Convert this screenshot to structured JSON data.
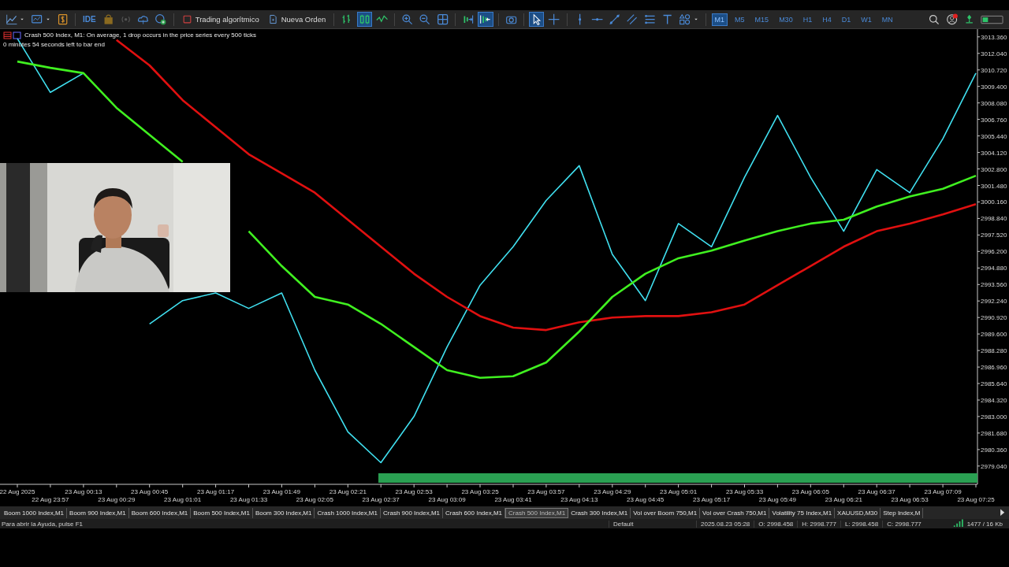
{
  "toolbar": {
    "ide_label": "IDE",
    "buttons": [
      {
        "label": "Trading algorítmico",
        "kind": "algo"
      },
      {
        "label": "Nueva Orden",
        "kind": "order"
      }
    ],
    "timeframes": [
      {
        "label": "M1",
        "selected": true
      },
      {
        "label": "M5",
        "selected": false
      },
      {
        "label": "M15",
        "selected": false
      },
      {
        "label": "M30",
        "selected": false
      },
      {
        "label": "H1",
        "selected": false
      },
      {
        "label": "H4",
        "selected": false
      },
      {
        "label": "D1",
        "selected": false
      },
      {
        "label": "W1",
        "selected": false
      },
      {
        "label": "MN",
        "selected": false
      }
    ]
  },
  "chart": {
    "info_lines": [
      "Crash 500 Index, M1:  On average, 1 drop occurs in the price series every 500 ticks",
      "0 minutes 54 seconds left to bar end"
    ],
    "chart_data": {
      "type": "line",
      "categories": [
        "22 Aug 2025",
        "22 Aug 23:57",
        "23 Aug 00:13",
        "23 Aug 00:29",
        "23 Aug 00:45",
        "23 Aug 01:01",
        "23 Aug 01:17",
        "23 Aug 01:33",
        "23 Aug 01:49",
        "23 Aug 02:05",
        "23 Aug 02:21",
        "23 Aug 02:37",
        "23 Aug 02:53",
        "23 Aug 03:09",
        "23 Aug 03:25",
        "23 Aug 03:41",
        "23 Aug 03:57",
        "23 Aug 04:13",
        "23 Aug 04:29",
        "23 Aug 04:45",
        "23 Aug 05:01",
        "23 Aug 05:17",
        "23 Aug 05:33",
        "23 Aug 05:49",
        "23 Aug 06:05",
        "23 Aug 06:21",
        "23 Aug 06:37",
        "23 Aug 06:53",
        "23 Aug 07:09",
        "23 Aug 07:25"
      ],
      "ylim": [
        2977.58,
        3013.98
      ],
      "yticks": [
        {
          "value": 3013.36,
          "label": "3013.360"
        },
        {
          "value": 3012.04,
          "label": "3012.040"
        },
        {
          "value": 3010.72,
          "label": "3010.720"
        },
        {
          "value": 3009.4,
          "label": "3009.400"
        },
        {
          "value": 3008.08,
          "label": "3008.080"
        },
        {
          "value": 3006.76,
          "label": "3006.760"
        },
        {
          "value": 3005.44,
          "label": "3005.440"
        },
        {
          "value": 3004.12,
          "label": "3004.120"
        },
        {
          "value": 3002.8,
          "label": "3002.800"
        },
        {
          "value": 3001.48,
          "label": "3001.480"
        },
        {
          "value": 3000.16,
          "label": "3000.160"
        },
        {
          "value": 2998.84,
          "label": "2998.840"
        },
        {
          "value": 2997.52,
          "label": "2997.520"
        },
        {
          "value": 2996.2,
          "label": "2996.200"
        },
        {
          "value": 2994.88,
          "label": "2994.880"
        },
        {
          "value": 2993.56,
          "label": "2993.560"
        },
        {
          "value": 2992.24,
          "label": "2992.240"
        },
        {
          "value": 2990.92,
          "label": "2990.920"
        },
        {
          "value": 2989.6,
          "label": "2989.600"
        },
        {
          "value": 2988.28,
          "label": "2988.280"
        },
        {
          "value": 2986.96,
          "label": "2986.960"
        },
        {
          "value": 2985.64,
          "label": "2985.640"
        },
        {
          "value": 2984.32,
          "label": "2984.320"
        },
        {
          "value": 2983,
          "label": "2983.000"
        },
        {
          "value": 2981.68,
          "label": "2981.680"
        },
        {
          "value": 2980.36,
          "label": "2980.360"
        },
        {
          "value": 2979.04,
          "label": "2979.040"
        }
      ],
      "series": [
        {
          "color": "#40e0f0",
          "values": [
            3013.24,
            3008.92,
            3010.46,
            null,
            2990.41,
            2992.27,
            2992.88,
            2991.65,
            2992.88,
            2986.71,
            2981.78,
            2979.31,
            2983.01,
            2988.56,
            2993.5,
            2996.58,
            3000.28,
            3003.06,
            2995.97,
            2992.27,
            2998.43,
            2996.58,
            3002.13,
            3007.07,
            3002.13,
            2997.82,
            3002.75,
            3000.9,
            3005.22,
            3010.46
          ]
        },
        {
          "color": "#e01010",
          "values": [
            null,
            null,
            null,
            3013.11,
            3011.08,
            3008.3,
            3006.14,
            3003.98,
            3002.44,
            3000.9,
            2998.74,
            2996.58,
            2994.42,
            2992.57,
            2991.03,
            2990.11,
            2989.92,
            2990.54,
            2990.91,
            2991.03,
            2991.03,
            2991.34,
            2991.96,
            2993.5,
            2995.04,
            2996.58,
            2997.82,
            2998.43,
            2999.17,
            2999.98
          ]
        },
        {
          "color": "#40f020",
          "values": [
            3011.39,
            3010.89,
            3010.46,
            3007.69,
            3005.53,
            3003.37,
            null,
            2997.82,
            2995.04,
            2992.57,
            2991.96,
            2990.41,
            2988.56,
            2986.71,
            2986.1,
            2986.22,
            2987.33,
            2989.8,
            2992.57,
            2994.42,
            2995.66,
            2996.27,
            2997.08,
            2997.82,
            2998.43,
            2998.74,
            2999.79,
            3000.59,
            3001.21,
            3002.26
          ]
        }
      ]
    }
  },
  "symbol_tabs": [
    {
      "label": "Boom 1000 Index,M1",
      "selected": false
    },
    {
      "label": "Boom 900 Index,M1",
      "selected": false
    },
    {
      "label": "Boom 600 Index,M1",
      "selected": false
    },
    {
      "label": "Boom 500 Index,M1",
      "selected": false
    },
    {
      "label": "Boom 300 Index,M1",
      "selected": false
    },
    {
      "label": "Crash 1000 Index,M1",
      "selected": false
    },
    {
      "label": "Crash 900 Index,M1",
      "selected": false
    },
    {
      "label": "Crash 600 Index,M1",
      "selected": false
    },
    {
      "label": "Crash 500 Index,M1",
      "selected": true
    },
    {
      "label": "Crash 300 Index,M1",
      "selected": false
    },
    {
      "label": "Vol over Boom 750,M1",
      "selected": false
    },
    {
      "label": "Vol over Crash 750,M1",
      "selected": false
    },
    {
      "label": "Volatility 75 Index,M1",
      "selected": false
    },
    {
      "label": "XAUUSD,M30",
      "selected": false
    },
    {
      "label": "Step Index,M",
      "selected": false
    }
  ],
  "status_bar": {
    "help": "Para abrir la Ayuda, pulse F1",
    "profile": "Default",
    "datetime": "2025.08.23 05:28",
    "open": "O: 2998.458",
    "high": "H: 2998.777",
    "low": "L: 2998.458",
    "close": "C: 2998.777",
    "traffic": "1477 / 16 Kb"
  }
}
